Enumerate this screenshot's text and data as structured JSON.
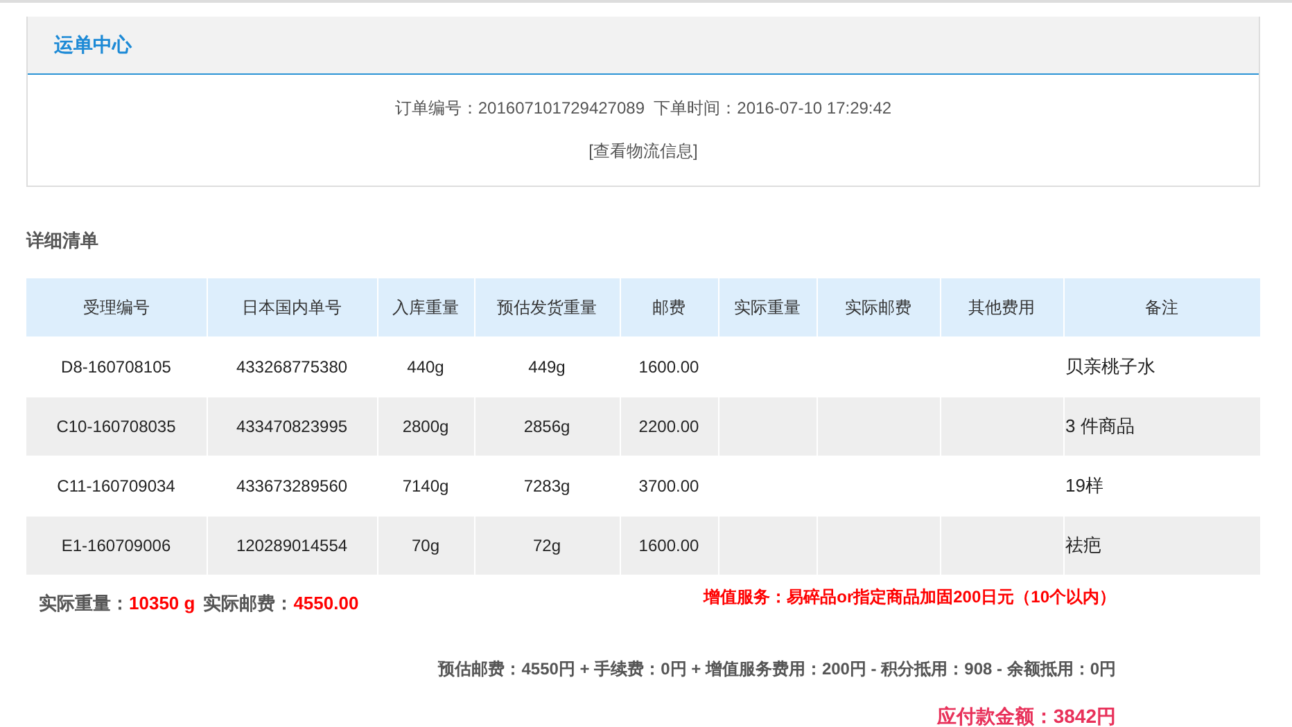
{
  "panel": {
    "title": "运单中心",
    "order_info": "订单编号：201607101729427089  下单时间：2016-07-10 17:29:42",
    "logistics_link": "[查看物流信息]"
  },
  "section_title": "详细清单",
  "table": {
    "columns": [
      "受理编号",
      "日本国内单号",
      "入库重量",
      "预估发货重量",
      "邮费",
      "实际重量",
      "实际邮费",
      "其他费用",
      "备注"
    ],
    "rows": [
      {
        "cells": [
          "D8-160708105",
          "433268775380",
          "440g",
          "449g",
          "1600.00",
          "",
          "",
          "",
          "贝亲桃子水"
        ]
      },
      {
        "cells": [
          "C10-160708035",
          "433470823995",
          "2800g",
          "2856g",
          "2200.00",
          "",
          "",
          "",
          "3 件商品"
        ]
      },
      {
        "cells": [
          "C11-160709034",
          "433673289560",
          "7140g",
          "7283g",
          "3700.00",
          "",
          "",
          "",
          "19样"
        ]
      },
      {
        "cells": [
          "E1-160709006",
          "120289014554",
          "70g",
          "72g",
          "1600.00",
          "",
          "",
          "",
          "祛疤"
        ]
      }
    ]
  },
  "totals": [
    {
      "label": "实际重量：",
      "value": "10350 g"
    },
    {
      "label": "实际邮费：",
      "value": "4550.00"
    }
  ],
  "service_note": "增值服务：易碎品or指定商品加固200日元（10个以内）",
  "fee_breakdown": "预估邮费：4550円 + 手续费：0円 + 增值服务费用：200円 - 积分抵用：908 - 余额抵用：0円",
  "amount_due": "应付款金额：3842円"
}
